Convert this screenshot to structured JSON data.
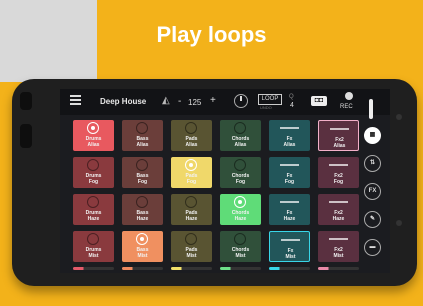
{
  "headline": "Play loops",
  "colors": {
    "background": "#f3b21a",
    "drums": "#8a3a3e",
    "bass": "#6b3e3a",
    "pads": "#595432",
    "chords": "#30503a",
    "fx": "#22565a",
    "fx2": "#5a3040"
  },
  "topbar": {
    "menu_icon": "hamburger-icon",
    "preset": "Deep House",
    "metronome_icon": "metronome-icon",
    "tempo_minus": "-",
    "tempo": "125",
    "tempo_plus": "+",
    "loop_label": "LOOP",
    "loop_sub": "UNDO",
    "count_label": "Q",
    "count_value": "4",
    "record_label": "REC"
  },
  "columns": [
    {
      "name": "Drums",
      "color": "#8a3a3e",
      "stripe": "#e45b6a"
    },
    {
      "name": "Bass",
      "color": "#6b3e3a",
      "stripe": "#f08a5e"
    },
    {
      "name": "Pads",
      "color": "#595432",
      "stripe": "#f3e26a"
    },
    {
      "name": "Chords",
      "color": "#30503a",
      "stripe": "#6ee08a"
    },
    {
      "name": "Fx",
      "color": "#22565a",
      "stripe": "#39d6e8"
    },
    {
      "name": "Fx2",
      "color": "#5a3040",
      "stripe": "#e88aa8"
    }
  ],
  "pads": [
    [
      {
        "line1": "Drums",
        "line2": "Alias",
        "state": "playing",
        "color": "#e8595f"
      },
      {
        "line1": "Bass",
        "line2": "Alias",
        "color": "#6b3e3a"
      },
      {
        "line1": "Pads",
        "line2": "Alias",
        "color": "#595432"
      },
      {
        "line1": "Chords",
        "line2": "Alias",
        "color": "#30503a"
      },
      {
        "line1": "Fx",
        "line2": "Alias",
        "icon": "dash",
        "color": "#22565a"
      },
      {
        "line1": "Fx2",
        "line2": "Alias",
        "icon": "dash",
        "state": "selected",
        "color": "#5a3040"
      }
    ],
    [
      {
        "line1": "Drums",
        "line2": "Fog",
        "color": "#8a3a3e"
      },
      {
        "line1": "Bass",
        "line2": "Fog",
        "color": "#6b3e3a"
      },
      {
        "line1": "Pads",
        "line2": "Fog",
        "state": "playing",
        "color": "#f0d86a"
      },
      {
        "line1": "Chords",
        "line2": "Fog",
        "color": "#30503a"
      },
      {
        "line1": "Fx",
        "line2": "Fog",
        "icon": "dash",
        "color": "#22565a"
      },
      {
        "line1": "Fx2",
        "line2": "Fog",
        "icon": "dash",
        "color": "#5a3040"
      }
    ],
    [
      {
        "line1": "Drums",
        "line2": "Haze",
        "color": "#8a3a3e"
      },
      {
        "line1": "Bass",
        "line2": "Haze",
        "color": "#6b3e3a"
      },
      {
        "line1": "Pads",
        "line2": "Haze",
        "color": "#595432"
      },
      {
        "line1": "Chords",
        "line2": "Haze",
        "state": "playing",
        "color": "#5fdc78"
      },
      {
        "line1": "Fx",
        "line2": "Haze",
        "icon": "dash",
        "color": "#22565a"
      },
      {
        "line1": "Fx2",
        "line2": "Haze",
        "icon": "dash",
        "color": "#5a3040"
      }
    ],
    [
      {
        "line1": "Drums",
        "line2": "Mist",
        "color": "#8a3a3e"
      },
      {
        "line1": "Bass",
        "line2": "Mist",
        "state": "playing",
        "color": "#f09060"
      },
      {
        "line1": "Pads",
        "line2": "Mist",
        "color": "#595432"
      },
      {
        "line1": "Chords",
        "line2": "Mist",
        "color": "#30503a"
      },
      {
        "line1": "Fx",
        "line2": "Mist",
        "icon": "dash",
        "state": "selected-cyan",
        "color": "#22565a"
      },
      {
        "line1": "Fx2",
        "line2": "Mist",
        "icon": "dash",
        "color": "#5a3040"
      }
    ]
  ],
  "sidebar": [
    {
      "name": "grid-icon",
      "glyph": "▦",
      "active": true
    },
    {
      "name": "mixer-icon",
      "glyph": "⇅",
      "active": false
    },
    {
      "name": "fx-icon",
      "glyph": "FX",
      "active": false
    },
    {
      "name": "edit-icon",
      "glyph": "✎",
      "active": false
    },
    {
      "name": "folder-icon",
      "glyph": "▬",
      "active": false
    }
  ]
}
